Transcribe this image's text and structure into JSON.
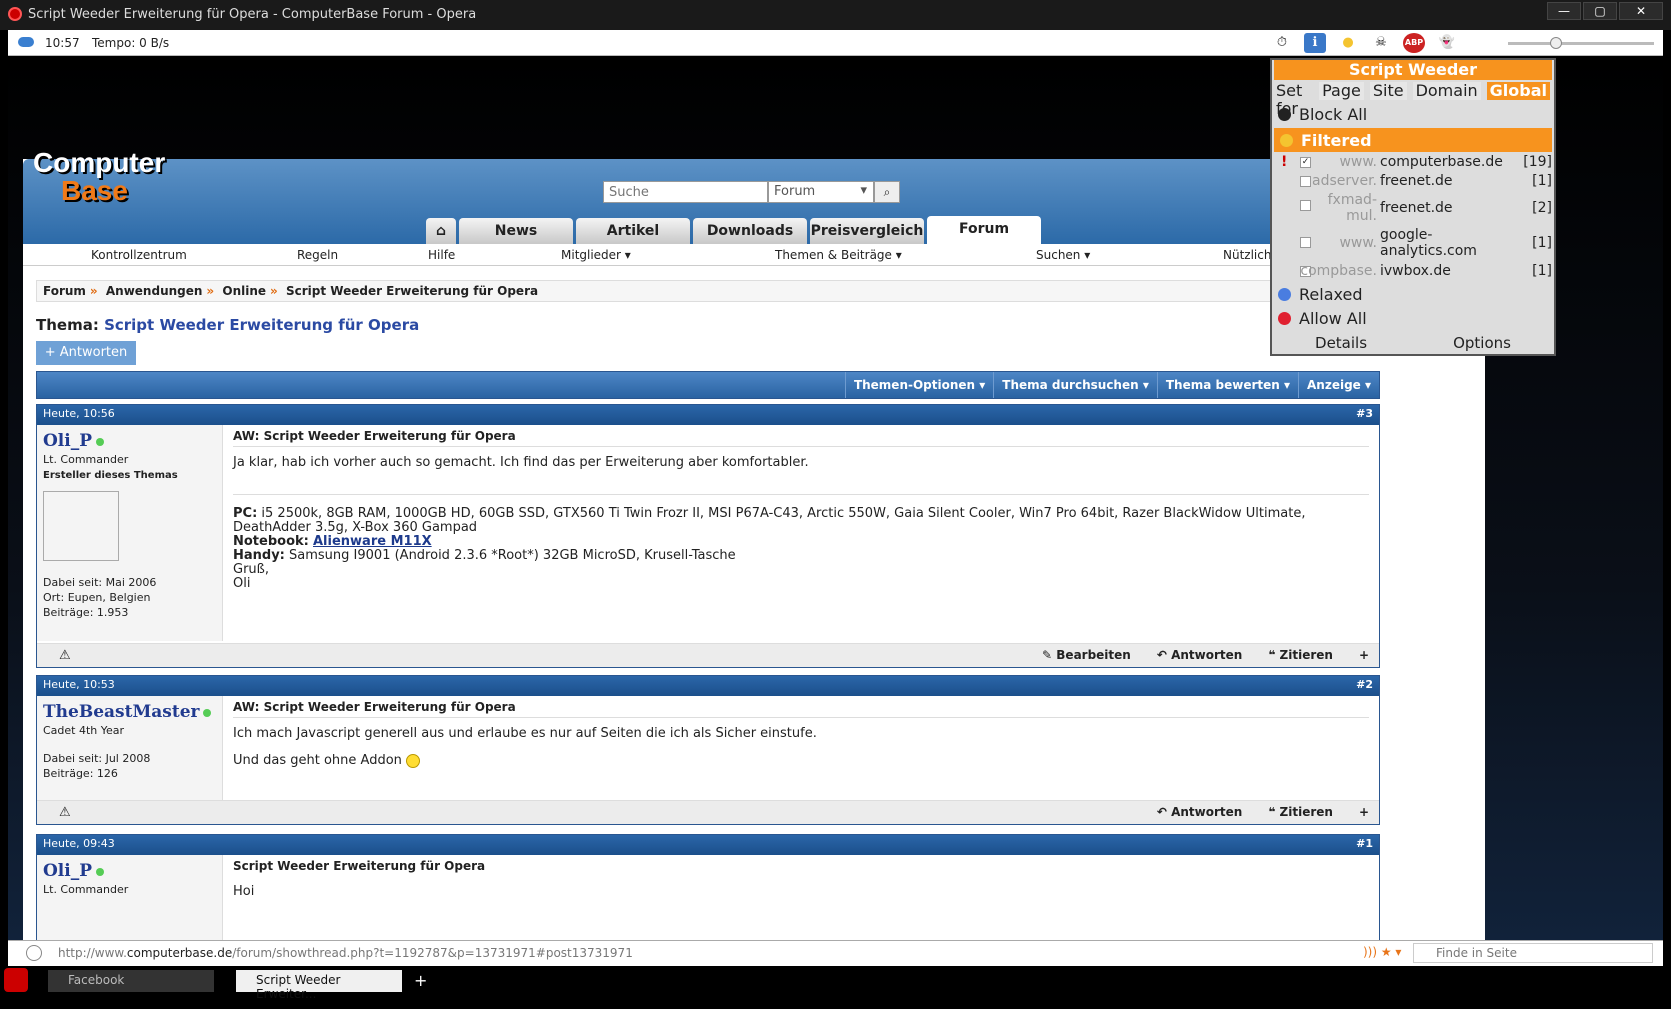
{
  "window": {
    "title": "Script Weeder Erweiterung für Opera - ComputerBase Forum - Opera",
    "controls": [
      "—",
      "▢",
      "✕"
    ]
  },
  "statusbar": {
    "time": "10:57",
    "tempo": "Tempo:  0 B/s",
    "icons": [
      "⏱",
      "ℹ",
      "●",
      "☠",
      "ABP",
      "👻"
    ]
  },
  "site": {
    "logo_line1": "Computer",
    "logo_line2": "Base",
    "search": {
      "placeholder": "Suche",
      "scope": "Forum"
    },
    "tabs": [
      "News",
      "Artikel",
      "Downloads",
      "Preisvergleich",
      "Forum"
    ],
    "active_tab": "Forum",
    "nav": [
      "Kontrollzentrum",
      "Regeln",
      "Hilfe",
      "Mitglieder ▾",
      "Themen & Beiträge ▾",
      "Suchen ▾",
      "Nützliche"
    ],
    "breadcrumb": [
      "Forum",
      "Anwendungen",
      "Online",
      "Script Weeder Erweiterung für Opera"
    ],
    "thread_label": "Thema:",
    "thread_title": "Script Weeder Erweiterung für Opera",
    "reply_button": "+ Antworten",
    "thread_options": [
      "Themen-Optionen ▾",
      "Thema durchsuchen ▾",
      "Thema bewerten ▾",
      "Anzeige ▾"
    ]
  },
  "posts": [
    {
      "date": "Heute, 10:56",
      "num": "#3",
      "user": "Oli_P",
      "rank": "Lt. Commander",
      "sub": "Ersteller dieses Themas",
      "meta": [
        "Dabei seit: Mai 2006",
        "Ort: Eupen, Belgien",
        "Beiträge: 1.953"
      ],
      "title": "AW: Script Weeder Erweiterung für Opera",
      "text": "Ja klar, hab ich vorher auch so gemacht. Ich find das per Erweiterung aber komfortabler.",
      "sig_pc_label": "PC:",
      "sig_pc": "i5 2500k, 8GB RAM, 1000GB HD, 60GB SSD, GTX560 Ti Twin Frozr II, MSI P67A-C43, Arctic 550W, Gaia Silent Cooler, Win7 Pro 64bit, Razer BlackWidow Ultimate, DeathAdder 3.5g, X-Box 360 Gampad",
      "sig_nb_label": "Notebook:",
      "sig_nb": "Alienware M11X",
      "sig_handy_label": "Handy:",
      "sig_handy": "Samsung I9001 (Android 2.3.6 *Root*) 32GB MicroSD, Krusell-Tasche",
      "sig_greet": "Gruß,",
      "sig_name": "Oli",
      "actions": [
        "✎ Bearbeiten",
        "↶ Antworten",
        "❝ Zitieren",
        "+"
      ]
    },
    {
      "date": "Heute, 10:53",
      "num": "#2",
      "user": "TheBeastMaster",
      "rank": "Cadet 4th Year",
      "meta": [
        "Dabei seit: Jul 2008",
        "Beiträge: 126"
      ],
      "title": "AW: Script Weeder Erweiterung für Opera",
      "text": "Ich mach Javascript generell aus und erlaube es nur auf Seiten die ich als Sicher einstufe.",
      "text2": "Und das geht ohne Addon",
      "actions": [
        "↶ Antworten",
        "❝ Zitieren",
        "+"
      ]
    },
    {
      "date": "Heute, 09:43",
      "num": "#1",
      "user": "Oli_P",
      "rank": "Lt. Commander",
      "title": "Script Weeder Erweiterung für Opera",
      "text": "Hoi"
    }
  ],
  "weeder": {
    "title": "Script Weeder",
    "set_for": "Set for",
    "scopes": [
      "Page",
      "Site",
      "Domain",
      "Global"
    ],
    "selected_scope": "Global",
    "block_all": "Block All",
    "filtered": "Filtered",
    "domains": [
      {
        "sub": "www.",
        "main": "computerbase.de",
        "count": "[19]",
        "checked": true,
        "flag": "!"
      },
      {
        "sub": "adserver.",
        "main": "freenet.de",
        "count": "[1]",
        "checked": false,
        "flag": ""
      },
      {
        "sub": "fxmad-mul.",
        "main": "freenet.de",
        "count": "[2]",
        "checked": false,
        "flag": ""
      },
      {
        "sub": "www.",
        "main": "google-analytics.com",
        "count": "[1]",
        "checked": false,
        "flag": ""
      },
      {
        "sub": "compbase.",
        "main": "ivwbox.de",
        "count": "[1]",
        "checked": false,
        "flag": ""
      }
    ],
    "relaxed": "Relaxed",
    "allow_all": "Allow All",
    "details": "Details",
    "options": "Options",
    "colors": {
      "accent": "#f7931e",
      "block": "#222222",
      "filtered": "#f4c430",
      "relaxed": "#4a7de0",
      "allow": "#e02030"
    }
  },
  "addressbar": {
    "url_prefix": "http://www.",
    "url_domain": "computerbase.de",
    "url_rest": "/forum/showthread.php?t=1192787&p=13731971#post13731971",
    "find_placeholder": "Finde in Seite"
  },
  "tabbar": {
    "tabs": [
      "Facebook",
      "Script Weeder Erweiter..."
    ]
  }
}
